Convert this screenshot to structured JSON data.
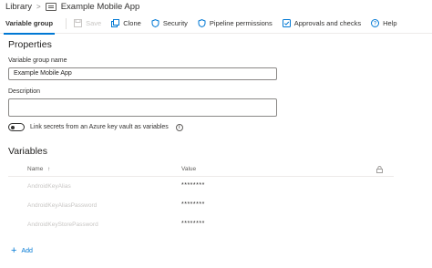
{
  "breadcrumb": {
    "root": "Library",
    "separator": ">",
    "current": "Example Mobile App"
  },
  "toolbar": {
    "tab_label": "Variable group",
    "buttons": [
      {
        "label": "Save",
        "icon": "save-icon",
        "disabled": true
      },
      {
        "label": "Clone",
        "icon": "clone-icon",
        "disabled": false
      },
      {
        "label": "Security",
        "icon": "shield-icon",
        "disabled": false
      },
      {
        "label": "Pipeline permissions",
        "icon": "shield-icon",
        "disabled": false
      },
      {
        "label": "Approvals and checks",
        "icon": "checklist-icon",
        "disabled": false
      },
      {
        "label": "Help",
        "icon": "help-icon",
        "disabled": false
      }
    ]
  },
  "properties": {
    "heading": "Properties",
    "name_label": "Variable group name",
    "name_value": "Example Mobile App",
    "description_label": "Description",
    "description_value": "",
    "link_secrets_label": "Link secrets from an Azure key vault as variables",
    "link_secrets_enabled": false
  },
  "variables": {
    "heading": "Variables",
    "col_name": "Name",
    "col_name_sort": "↑",
    "col_value": "Value",
    "rows": [
      {
        "name": "AndroidKeyAlias",
        "value": "********"
      },
      {
        "name": "AndroidKeyAliasPassword",
        "value": "********"
      },
      {
        "name": "AndroidKeyStorePassword",
        "value": "********"
      }
    ],
    "add_label": "Add"
  },
  "colors": {
    "accent": "#0078d4",
    "disabled_text": "#c8c6c4",
    "text": "#201f1e"
  }
}
